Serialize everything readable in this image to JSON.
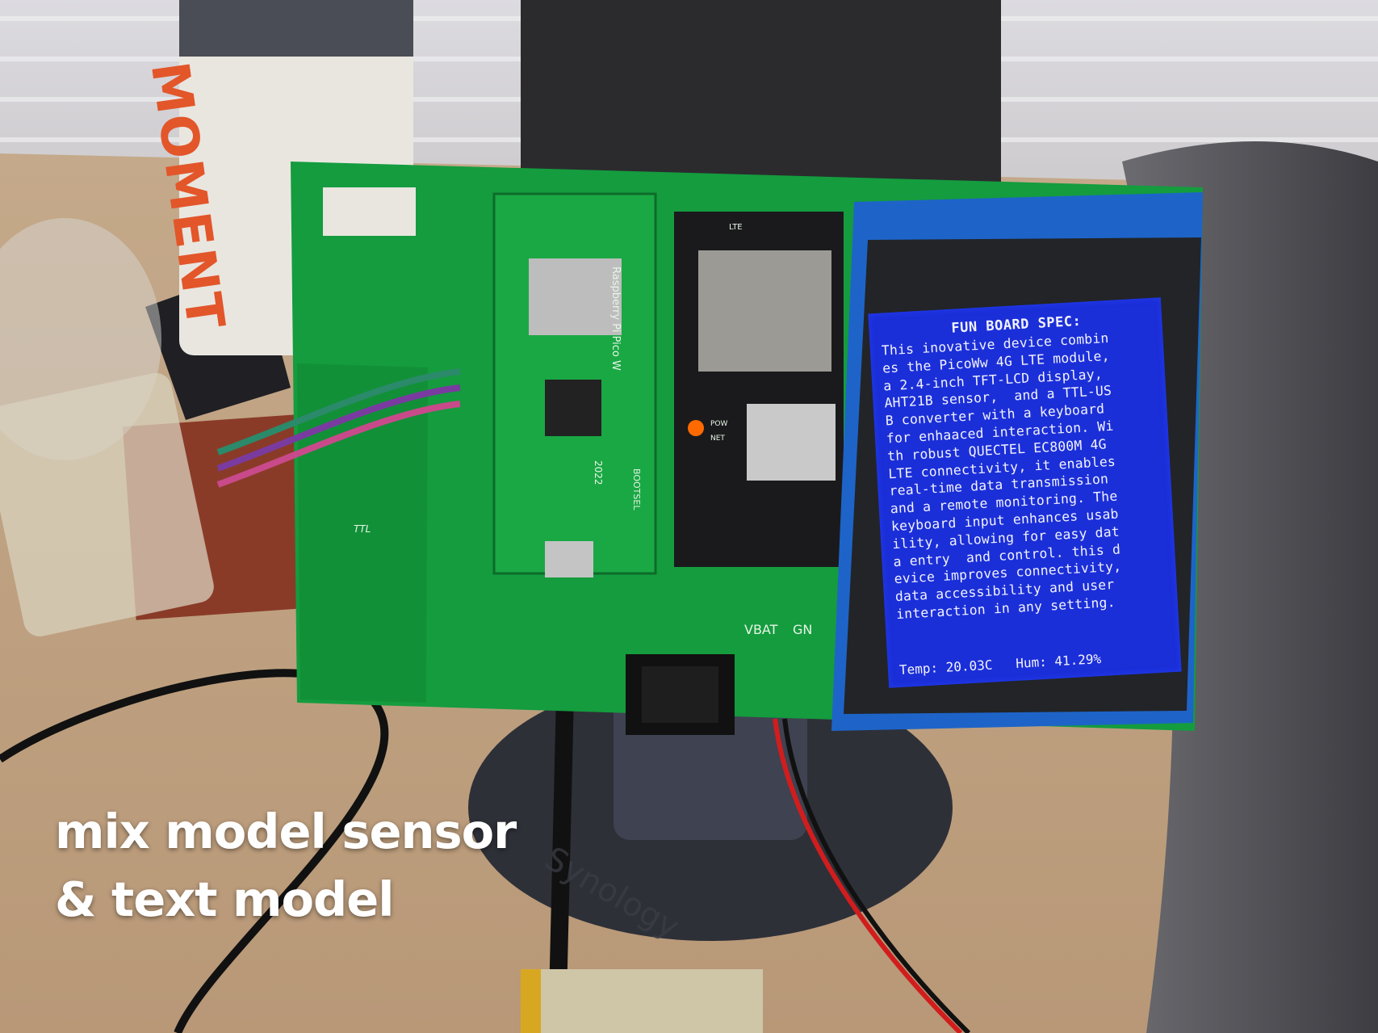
{
  "caption": {
    "line1": "mix model sensor",
    "line2": "& text model"
  },
  "lcd": {
    "title": "FUN BOARD SPEC:",
    "lines": [
      "This inovative device combin",
      "es the PicoWw 4G LTE module,",
      "a 2.4-inch TFT-LCD display,",
      "AHT21B sensor,  and a TTL-US",
      "B converter with a keyboard",
      "for enhaaced interaction. Wi",
      "th robust QUECTEL EC800M 4G",
      "LTE connectivity, it enables",
      "real-time data transmission",
      "and a remote monitoring. The",
      "keyboard input enhances usab",
      "ility, allowing for easy dat",
      "a entry  and control. this d",
      "evice improves connectivity,",
      "data accessibility and user",
      "interaction in any setting."
    ],
    "footer": "Temp: 20.03C   Hum: 41.29%"
  },
  "silkscreen": {
    "pico_label": "Raspberry Pi Pico W",
    "year": "2022",
    "bootsel": "BOOTSEL",
    "ttl": "TTL",
    "vbat": "VBAT",
    "gnd": "GN",
    "lte": "LTE",
    "pow": "POW",
    "net": "NET"
  },
  "background_text": {
    "bottle": "MOMENT",
    "stand": "Synology"
  },
  "colors": {
    "pcb": "#149c3e",
    "lcd_bg": "#1b2fd8",
    "caption": "#ffffff"
  }
}
